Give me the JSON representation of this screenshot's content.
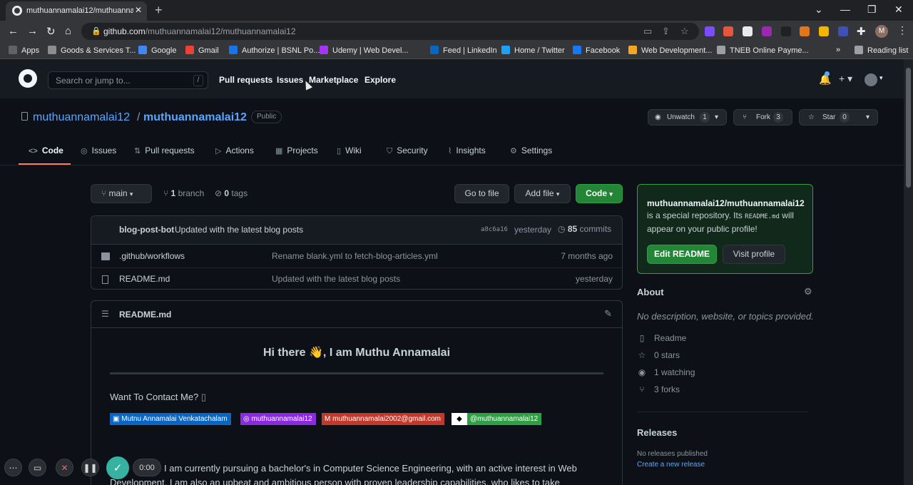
{
  "browser": {
    "tab_title": "muthuannamalai12/muthuannamalai12",
    "url_host": "github.com",
    "url_path": "/muthuannamalai12/muthuannamalai12",
    "profile_initial": "M",
    "window_min": "—",
    "window_max": "❐",
    "window_close": "✕",
    "reading_list": "Reading list",
    "bookmarks": [
      {
        "label": "Apps",
        "color": "#5f6368"
      },
      {
        "label": "Goods & Services T...",
        "color": "#8d8d8d"
      },
      {
        "label": "Google",
        "color": "#4285f4"
      },
      {
        "label": "Gmail",
        "color": "#ea4335"
      },
      {
        "label": "Authorize | BSNL Po...",
        "color": "#1a73e8"
      },
      {
        "label": "Udemy | Web Devel...",
        "color": "#a435f0"
      },
      {
        "label": "Feed | LinkedIn",
        "color": "#0a66c2"
      },
      {
        "label": "Home / Twitter",
        "color": "#1da1f2"
      },
      {
        "label": "Facebook",
        "color": "#1877f2"
      },
      {
        "label": "Web Development...",
        "color": "#f5a623"
      },
      {
        "label": "TNEB Online Payme...",
        "color": "#9aa0a6"
      }
    ]
  },
  "gh": {
    "search_placeholder": "Search or jump to...",
    "search_key": "/",
    "nav": [
      "Pull requests",
      "Issues",
      "Marketplace",
      "Explore"
    ]
  },
  "repo": {
    "owner": "muthuannamalai12",
    "separator": "/",
    "name": "muthuannamalai12",
    "visibility": "Public",
    "watch_label": "Unwatch",
    "watch_count": "1",
    "fork_label": "Fork",
    "fork_count": "3",
    "star_label": "Star",
    "star_count": "0",
    "tabs": [
      "Code",
      "Issues",
      "Pull requests",
      "Actions",
      "Projects",
      "Wiki",
      "Security",
      "Insights",
      "Settings"
    ],
    "branch": "main",
    "branch_count": "1",
    "branch_word": "branch",
    "tag_count": "0",
    "tag_word": "tags",
    "go_to_file": "Go to file",
    "add_file": "Add file",
    "code_btn": "Code"
  },
  "commit": {
    "author": "blog-post-bot",
    "message": "Updated with the latest blog posts",
    "sha": "a8c6a16",
    "when": "yesterday",
    "count": "85",
    "count_word": "commits"
  },
  "files": [
    {
      "name": ".github/workflows",
      "message": "Rename blank.yml to fetch-blog-articles.yml",
      "age": "7 months ago",
      "type": "dir"
    },
    {
      "name": "README.md",
      "message": "Updated with the latest blog posts",
      "age": "yesterday",
      "type": "file"
    }
  ],
  "readme": {
    "file": "README.md",
    "heading_a": "Hi there",
    "heading_emoji": "👋",
    "heading_b": ", I am Muthu Annamalai",
    "contact": "Want To Contact Me?",
    "badges": [
      {
        "label": "Mutnu Annamalai Venkatachalam",
        "color": "#0a66c2"
      },
      {
        "label": "muthuannamalai12",
        "color": "#8a2be2"
      },
      {
        "label": "muthuannamalai2002@gmail.com",
        "color": "#c0392b"
      },
      {
        "label": "@muthuannamalai12",
        "color": "#2ea043"
      }
    ],
    "para": "I am currently pursuing a bachelor's in Computer Science Engineering, with an active interest in Web Development. I am also an upbeat and ambitious person with proven leadership capabilities, who likes to take"
  },
  "sidebar": {
    "profile_owner": "muthuannamalai12/muthuannamalai12",
    "profile_text_1": " is a special repository. Its ",
    "profile_code": "README.md",
    "profile_text_2": " will appear on your public profile!",
    "edit_readme": "Edit README",
    "visit_profile": "Visit profile",
    "about_title": "About",
    "about_desc": "No description, website, or topics provided.",
    "readme_link": "Readme",
    "stars": "0 stars",
    "watching": "1 watching",
    "forks": "3 forks",
    "releases_title": "Releases",
    "no_releases": "No releases published",
    "create_release": "Create a new release"
  },
  "recorder": {
    "time": "0:00"
  }
}
